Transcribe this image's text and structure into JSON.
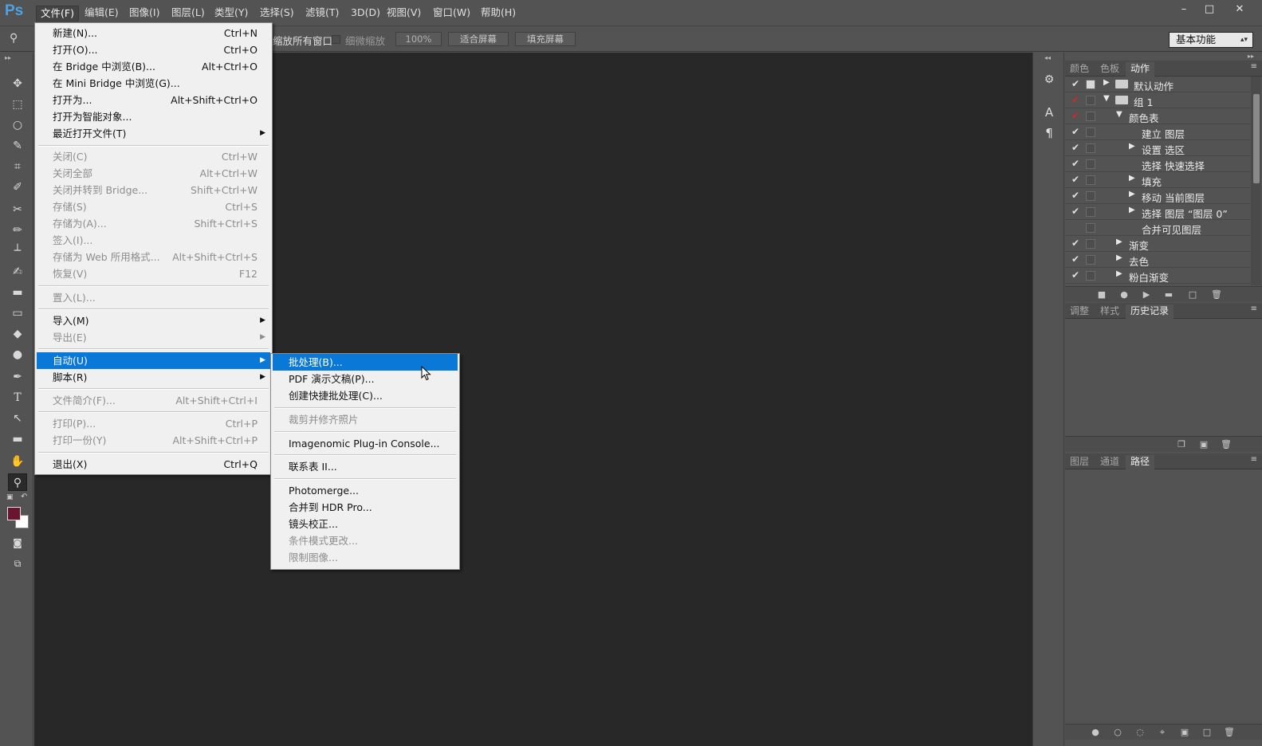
{
  "app": {
    "logo": "Ps"
  },
  "menubar": {
    "items": [
      "文件(F)",
      "编辑(E)",
      "图像(I)",
      "图层(L)",
      "类型(Y)",
      "选择(S)",
      "滤镜(T)",
      "3D(D)",
      "视图(V)",
      "窗口(W)",
      "帮助(H)"
    ],
    "window_buttons": [
      "minimize-icon",
      "maximize-icon",
      "close-icon"
    ]
  },
  "options_bar": {
    "tool_icon": "zoom-icon",
    "all_windows_label": "缩放所有窗口",
    "scrubby_zoom_label": "细微缩放",
    "zoom_percent": "100%",
    "fit_screen": "适合屏幕",
    "fill_screen": "填充屏幕",
    "workspace": "基本功能"
  },
  "file_menu": {
    "items": [
      {
        "label": "新建(N)...",
        "shortcut": "Ctrl+N",
        "enabled": true
      },
      {
        "label": "打开(O)...",
        "shortcut": "Ctrl+O",
        "enabled": true
      },
      {
        "label": "在 Bridge 中浏览(B)...",
        "shortcut": "Alt+Ctrl+O",
        "enabled": true
      },
      {
        "label": "在 Mini Bridge 中浏览(G)...",
        "shortcut": "",
        "enabled": true
      },
      {
        "label": "打开为...",
        "shortcut": "Alt+Shift+Ctrl+O",
        "enabled": true
      },
      {
        "label": "打开为智能对象...",
        "shortcut": "",
        "enabled": true
      },
      {
        "label": "最近打开文件(T)",
        "shortcut": "",
        "enabled": true,
        "submenu": true
      },
      {
        "label": "关闭(C)",
        "shortcut": "Ctrl+W",
        "enabled": false
      },
      {
        "label": "关闭全部",
        "shortcut": "Alt+Ctrl+W",
        "enabled": false
      },
      {
        "label": "关闭并转到 Bridge...",
        "shortcut": "Shift+Ctrl+W",
        "enabled": false
      },
      {
        "label": "存储(S)",
        "shortcut": "Ctrl+S",
        "enabled": false
      },
      {
        "label": "存储为(A)...",
        "shortcut": "Shift+Ctrl+S",
        "enabled": false
      },
      {
        "label": "签入(I)...",
        "shortcut": "",
        "enabled": false
      },
      {
        "label": "存储为 Web 所用格式...",
        "shortcut": "Alt+Shift+Ctrl+S",
        "enabled": false
      },
      {
        "label": "恢复(V)",
        "shortcut": "F12",
        "enabled": false
      },
      {
        "label": "置入(L)...",
        "shortcut": "",
        "enabled": false
      },
      {
        "label": "导入(M)",
        "shortcut": "",
        "enabled": true,
        "submenu": true
      },
      {
        "label": "导出(E)",
        "shortcut": "",
        "enabled": false,
        "submenu": true
      },
      {
        "label": "自动(U)",
        "shortcut": "",
        "enabled": true,
        "submenu": true,
        "highlighted": true
      },
      {
        "label": "脚本(R)",
        "shortcut": "",
        "enabled": true,
        "submenu": true
      },
      {
        "label": "文件简介(F)...",
        "shortcut": "Alt+Shift+Ctrl+I",
        "enabled": false
      },
      {
        "label": "打印(P)...",
        "shortcut": "Ctrl+P",
        "enabled": false
      },
      {
        "label": "打印一份(Y)",
        "shortcut": "Alt+Shift+Ctrl+P",
        "enabled": false
      },
      {
        "label": "退出(X)",
        "shortcut": "Ctrl+Q",
        "enabled": true
      }
    ]
  },
  "automate_submenu": {
    "items": [
      {
        "label": "批处理(B)...",
        "enabled": true,
        "highlighted": true
      },
      {
        "label": "PDF 演示文稿(P)...",
        "enabled": true
      },
      {
        "label": "创建快捷批处理(C)...",
        "enabled": true
      },
      {
        "label": "裁剪并修齐照片",
        "enabled": false
      },
      {
        "label": "Imagenomic Plug-in Console...",
        "enabled": true
      },
      {
        "label": "联系表 II...",
        "enabled": true
      },
      {
        "label": "Photomerge...",
        "enabled": true
      },
      {
        "label": "合并到 HDR Pro...",
        "enabled": true
      },
      {
        "label": "镜头校正...",
        "enabled": true
      },
      {
        "label": "条件模式更改...",
        "enabled": false
      },
      {
        "label": "限制图像...",
        "enabled": false
      }
    ]
  },
  "panels": {
    "top_tabs": [
      "颜色",
      "色板",
      "动作"
    ],
    "actions": [
      {
        "label": "默认动作",
        "checked": true,
        "red": false,
        "dialog": true,
        "expander": "collapsed",
        "folder": true
      },
      {
        "label": "组 1",
        "checked": true,
        "red": true,
        "dialog": false,
        "expander": "expanded",
        "folder": true
      },
      {
        "label": "颜色表",
        "checked": true,
        "red": true,
        "dialog": false,
        "expander": "expanded",
        "folder": false
      },
      {
        "label": "建立 图层",
        "checked": true,
        "red": false,
        "dialog": false,
        "expander": "",
        "folder": false
      },
      {
        "label": "设置 选区",
        "checked": true,
        "red": false,
        "dialog": false,
        "expander": "collapsed",
        "folder": false
      },
      {
        "label": "选择 快速选择",
        "checked": true,
        "red": false,
        "dialog": false,
        "expander": "",
        "folder": false
      },
      {
        "label": "填充",
        "checked": true,
        "red": false,
        "dialog": false,
        "expander": "collapsed",
        "folder": false
      },
      {
        "label": "移动 当前图层",
        "checked": true,
        "red": false,
        "dialog": false,
        "expander": "collapsed",
        "folder": false
      },
      {
        "label": "选择 图层 “图层 0”",
        "checked": true,
        "red": false,
        "dialog": false,
        "expander": "collapsed",
        "folder": false
      },
      {
        "label": "合并可见图层",
        "checked": false,
        "red": false,
        "dialog": false,
        "expander": "",
        "folder": false
      },
      {
        "label": "渐变",
        "checked": true,
        "red": false,
        "dialog": false,
        "expander": "collapsed",
        "folder": false
      },
      {
        "label": "去色",
        "checked": true,
        "red": false,
        "dialog": false,
        "expander": "collapsed",
        "folder": false
      },
      {
        "label": "粉白渐变",
        "checked": true,
        "red": false,
        "dialog": false,
        "expander": "collapsed",
        "folder": false
      }
    ],
    "mid_tabs": [
      "调整",
      "样式",
      "历史记录"
    ],
    "bottom_tabs": [
      "图层",
      "通道",
      "路径"
    ]
  },
  "colors": {
    "foreground": "#6b1530",
    "background": "#ffffff",
    "highlight": "#0a78d7"
  }
}
